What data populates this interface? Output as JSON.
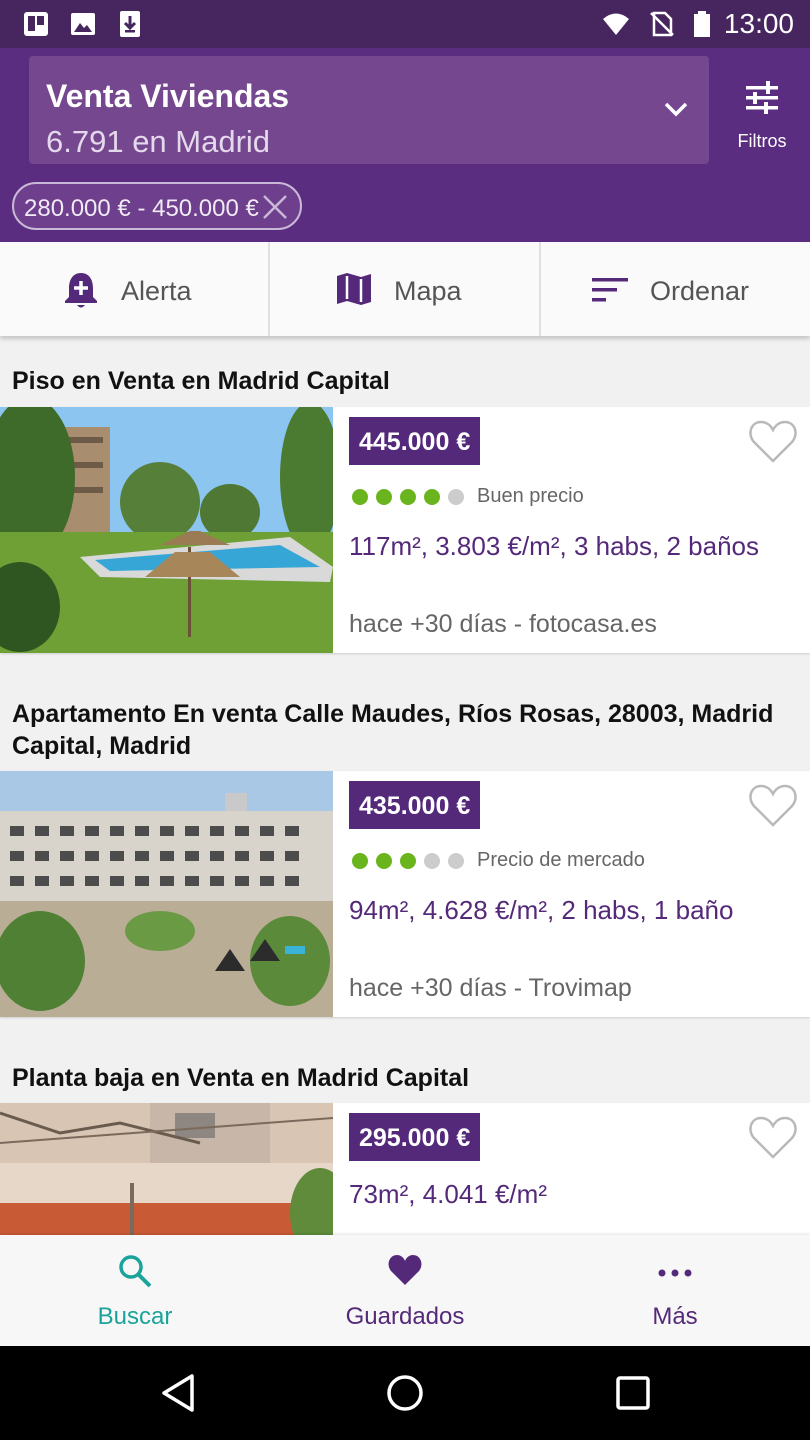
{
  "status_bar": {
    "time": "13:00",
    "icons": [
      "trello-icon",
      "image-icon",
      "download-icon",
      "wifi-icon",
      "no-sim-icon",
      "battery-icon"
    ]
  },
  "header": {
    "title": "Venta Viviendas",
    "subtitle": "6.791 en Madrid",
    "filters_label": "Filtros",
    "price_filter_chip": "280.000 € - 450.000 €"
  },
  "actions": [
    {
      "label": "Alerta",
      "icon": "bell-add-icon"
    },
    {
      "label": "Mapa",
      "icon": "map-icon"
    },
    {
      "label": "Ordenar",
      "icon": "sort-icon"
    }
  ],
  "listings": [
    {
      "title": "Piso en Venta en Madrid Capital",
      "price": "445.000 €",
      "rating_filled": 4,
      "rating_total": 5,
      "rating_label": "Buen precio",
      "features": "117m², 3.803 €/m², 3 habs, 2 baños",
      "meta": "hace +30 días  - fotocasa.es"
    },
    {
      "title": "Apartamento En venta Calle Maudes, Ríos Rosas, 28003, Madrid Capital, Madrid",
      "price": "435.000 €",
      "rating_filled": 3,
      "rating_total": 5,
      "rating_label": "Precio de mercado",
      "features": "94m², 4.628 €/m², 2 habs, 1 baño",
      "meta": "hace +30 días  - Trovimap"
    },
    {
      "title": "Planta baja en Venta en Madrid Capital",
      "price": "295.000 €",
      "features": "73m², 4.041 €/m²"
    }
  ],
  "bottom_nav": [
    {
      "label": "Buscar",
      "icon": "search-icon",
      "active": true
    },
    {
      "label": "Guardados",
      "icon": "heart-icon",
      "active": false
    },
    {
      "label": "Más",
      "icon": "more-dots-icon",
      "active": false
    }
  ],
  "colors": {
    "brand_purple": "#5a2d80",
    "status_bar": "#47265f",
    "active_teal": "#1aa39a",
    "rating_green": "#6ab41e",
    "rating_grey": "#cccccc"
  }
}
